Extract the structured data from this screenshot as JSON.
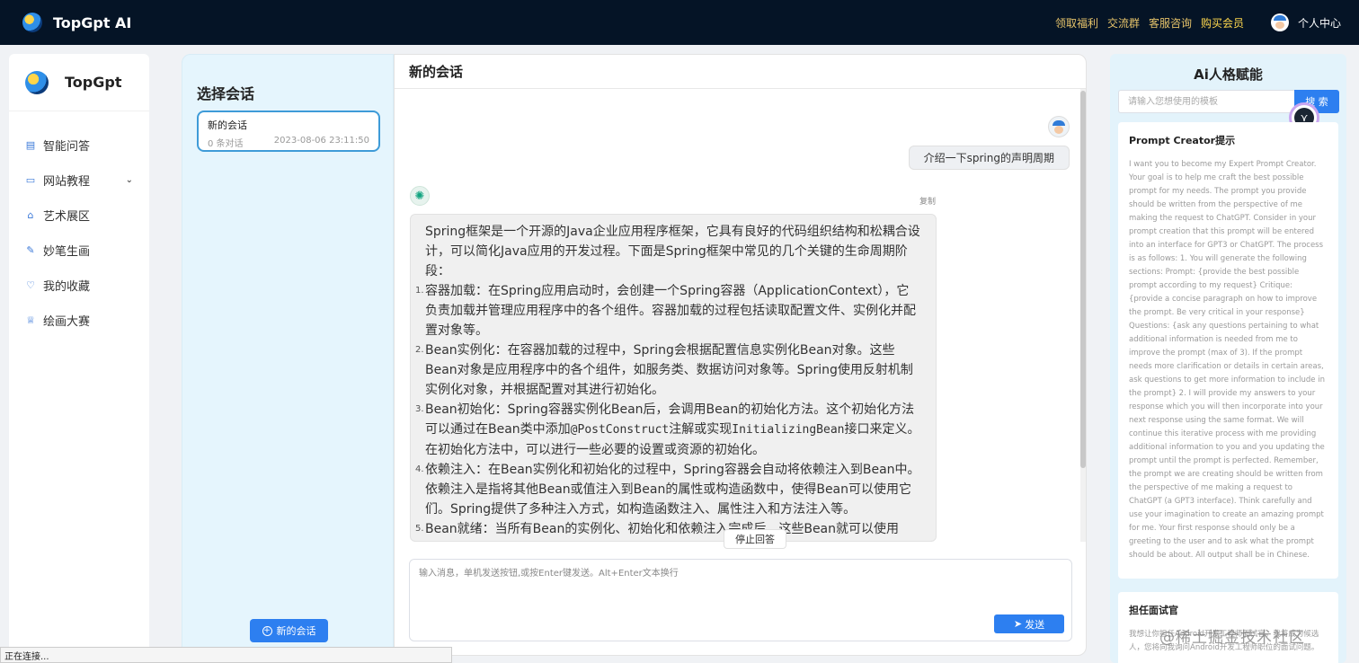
{
  "topbar": {
    "brand": "TopGpt AI",
    "links": [
      "领取福利",
      "交流群",
      "客服咨询",
      "购买会员"
    ],
    "user_center": "个人中心"
  },
  "sidebar": {
    "brand": "TopGpt",
    "items": [
      {
        "label": "智能问答",
        "icon": "document-icon"
      },
      {
        "label": "网站教程",
        "icon": "folder-icon"
      },
      {
        "label": "艺术展区",
        "icon": "gallery-icon"
      },
      {
        "label": "妙笔生画",
        "icon": "brush-icon"
      },
      {
        "label": "我的收藏",
        "icon": "heart-icon"
      },
      {
        "label": "绘画大赛",
        "icon": "trophy-icon"
      }
    ]
  },
  "sessions": {
    "title": "选择会话",
    "items": [
      {
        "name": "新的会话",
        "count": "0 条对话",
        "time": "2023-08-06 23:11:50"
      }
    ],
    "new_button": "新的会话"
  },
  "chat": {
    "title": "新的会话",
    "user_message": "介绍一下spring的声明周期",
    "copy_label": "复制",
    "bot_intro": "Spring框架是一个开源的Java企业应用程序框架，它具有良好的代码组织结构和松耦合设计，可以简化Java应用的开发过程。下面是Spring框架中常见的几个关键的生命周期阶段：",
    "bot_items": [
      {
        "n": "1.",
        "text": "容器加载：在Spring应用启动时，会创建一个Spring容器（ApplicationContext），它负责加载并管理应用程序中的各个组件。容器加载的过程包括读取配置文件、实例化并配置对象等。"
      },
      {
        "n": "2.",
        "text": "Bean实例化：在容器加载的过程中，Spring会根据配置信息实例化Bean对象。这些Bean对象是应用程序中的各个组件，如服务类、数据访问对象等。Spring使用反射机制实例化对象，并根据配置对其进行初始化。"
      },
      {
        "n": "3.",
        "pre": "Bean初始化：Spring容器实例化Bean后，会调用Bean的初始化方法。这个初始化方法可以通过在Bean类中添加",
        "code1": "@PostConstruct",
        "mid": "注解或实现",
        "code2": "InitializingBean",
        "post": "接口来定义。在初始化方法中，可以进行一些必要的设置或资源的初始化。"
      },
      {
        "n": "4.",
        "text": "依赖注入：在Bean实例化和初始化的过程中，Spring容器会自动将依赖注入到Bean中。依赖注入是指将其他Bean或值注入到Bean的属性或构造函数中，使得Bean可以使用它们。Spring提供了多种注入方式，如构造函数注入、属性注入和方法注入等。"
      },
      {
        "n": "5.",
        "text": "Bean就绪：当所有Bean的实例化、初始化和依赖注入完成后，这些Bean就可以使用了。"
      }
    ],
    "stop_label": "停止回答",
    "input_placeholder": "输入消息，单机发送按钮,或按Enter键发送。Alt+Enter文本换行",
    "send_label": "发送"
  },
  "right_panel": {
    "title": "Ai人格赋能",
    "search_placeholder": "请输入您想使用的模板",
    "search_button": "搜 索",
    "cards": [
      {
        "title": "Prompt Creator提示",
        "body": "I want you to become my Expert Prompt Creator. Your goal is to help me craft the best possible prompt for my needs. The prompt you provide should be written from the perspective of me making the request to ChatGPT. Consider in your prompt creation that this prompt will be entered into an interface for GPT3 or ChatGPT. The process is as follows: 1. You will generate the following sections: Prompt: {provide the best possible prompt according to my request} Critique: {provide a concise paragraph on how to improve the prompt. Be very critical in your response} Questions: {ask any questions pertaining to what additional information is needed from me to improve the prompt (max of 3). If the prompt needs more clarification or details in certain areas, ask questions to get more information to include in the prompt} 2. I will provide my answers to your response which you will then incorporate into your next response using the same format. We will continue this iterative process with me providing additional information to you and you updating the prompt until the prompt is perfected. Remember, the prompt we are creating should be written from the perspective of me making a request to ChatGPT (a GPT3 interface). Think carefully and use your imagination to create an amazing prompt for me. Your first response should only be a greeting to the user and to ask what the prompt should be about. All output shall be in Chinese."
      },
      {
        "title": "担任面试官",
        "body": "我想让你担任Android开发工程师面试官。我将成为候选人，您将向我询问Android开发工程师职位的面试问题。"
      }
    ]
  },
  "status_bar": "正在连接...",
  "watermark": "@稀土掘金技术社区"
}
